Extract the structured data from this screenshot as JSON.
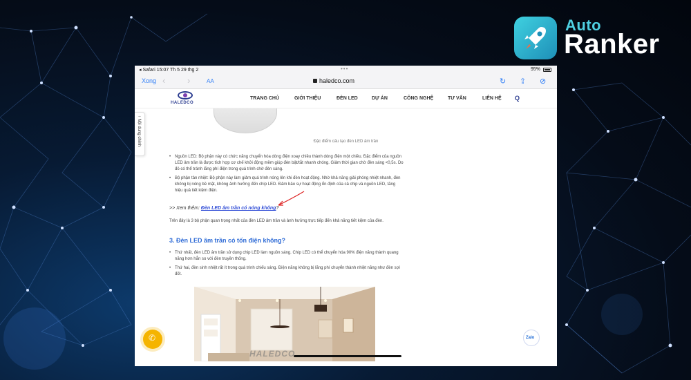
{
  "brand": {
    "line1": "Auto",
    "line2": "Ranker"
  },
  "statusbar": {
    "left": "◂ Safari   15:07   Th 5 29 thg 2",
    "dots": "•••",
    "battery": "95%"
  },
  "safari": {
    "done": "Xong",
    "aa": "AA",
    "url": "haledco.com",
    "back": "‹",
    "forward": "›"
  },
  "site": {
    "logo": "HALEDCO",
    "menu": [
      "TRANG CHỦ",
      "GIỚI THIỆU",
      "ĐÈN LED",
      "DỰ ÁN",
      "CÔNG NGHỆ",
      "TƯ VẤN",
      "LIÊN HỆ"
    ]
  },
  "sidebar_tab": "↑ Nội dung chính",
  "article": {
    "caption": "Đặc điểm cấu tạo đèn LED âm trần",
    "bullets1": [
      "Nguồn LED: Bộ phận này có chức năng chuyển hóa dòng điện xoay chiều thành dòng điện một chiều. Đặc điểm của nguồn LED âm trần là được tích hợp cơ chế khởi động mềm giúp đèn bật/tắt nhanh chóng. Giảm thời gian chờ đèn sáng <0,5s. Do đó có thể tránh lãng phí điện trong quá trình chờ đèn sáng.",
      "Bộ phận tản nhiệt: Bộ phận này làm giảm quá trình nóng lên khi đèn hoạt động. Nhờ khả năng giải phóng nhiệt nhanh, đèn không bị nóng bề mặt, không ảnh hưởng đến chip LED. Đảm bảo sự hoạt động ổn định của cả chip và nguồn LED, tăng hiệu quả tiết kiệm điện."
    ],
    "seemore_prefix": ">> Xem thêm: ",
    "seemore_link": "Đèn LED âm trần có nóng không",
    "seemore_suffix": "?",
    "para": "Trên đây là 3 bộ phận quan trọng nhất của đèn LED âm trần và ảnh hưởng trực tiếp đến khả năng tiết kiệm của đèn.",
    "heading": "3. Đèn LED âm trần có tốn điện không?",
    "bullets2": [
      "Thứ nhất, đèn LED âm trần sử dụng chip LED làm nguồn sáng. Chip LED có thể chuyển hóa 90% điện năng thành quang năng hơn hẳn so với đèn truyền thống.",
      "Thứ hai, đèn sinh nhiệt rất ít trong quá trình chiếu sáng. Điện năng không bị lãng phí chuyển thành nhiệt năng như đèn sợi đốt."
    ],
    "watermark": "HALEDCO"
  },
  "widgets": {
    "zalo": "Zalo"
  },
  "colors": {
    "accent": "#2e7df6",
    "heading": "#2e6bd6",
    "brand_blue": "#2a3b8f",
    "call": "#f5b400",
    "brand_cyan": "#4fd0e2"
  }
}
